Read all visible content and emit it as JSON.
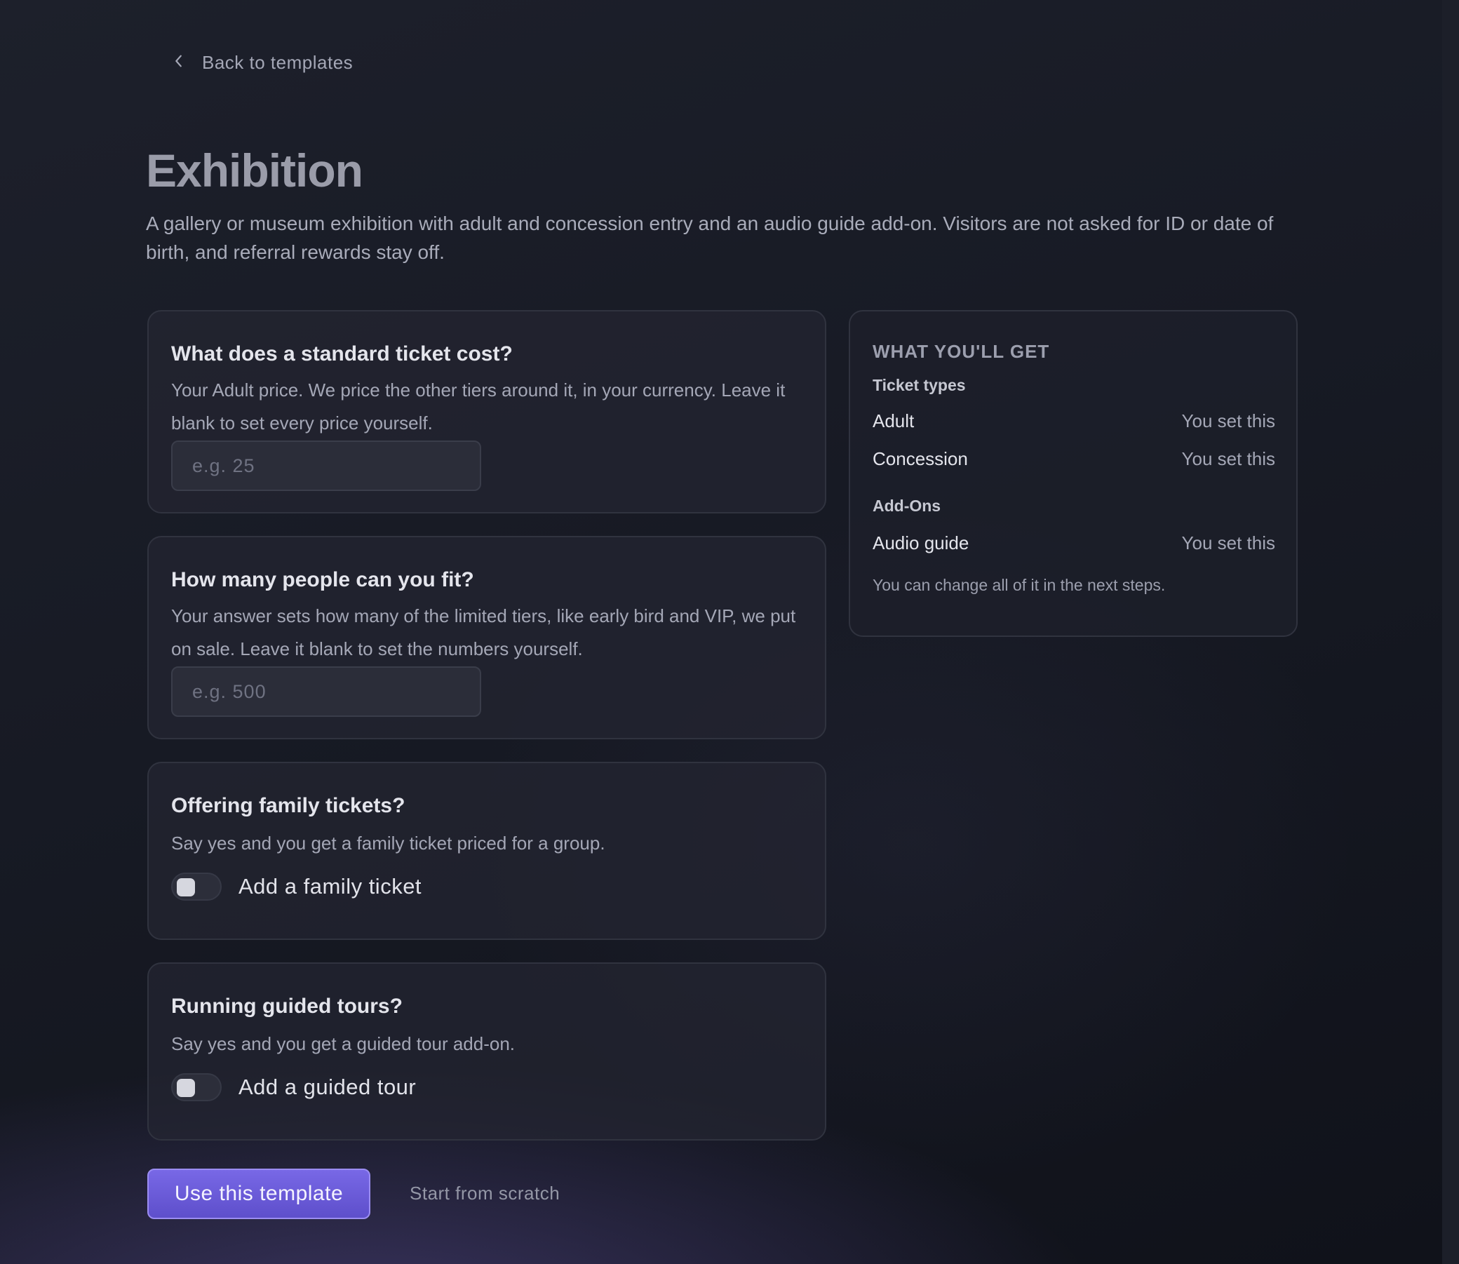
{
  "nav": {
    "back_label": "Back to templates"
  },
  "header": {
    "title": "Exhibition",
    "description": "A gallery or museum exhibition with adult and concession entry and an audio guide add-on. Visitors are not asked for ID or date of birth, and referral rewards stay off."
  },
  "questions": {
    "price": {
      "question": "What does a standard ticket cost?",
      "help": "Your Adult price. We price the other tiers around it, in your currency. Leave it blank to set every price yourself.",
      "value": "",
      "placeholder": "e.g. 25"
    },
    "capacity": {
      "question": "How many people can you fit?",
      "help": "Your answer sets how many of the limited tiers, like early bird and VIP, we put on sale. Leave it blank to set the numbers yourself.",
      "value": "",
      "placeholder": "e.g. 500"
    },
    "family": {
      "question": "Offering family tickets?",
      "help": "Say yes and you get a family ticket priced for a group.",
      "toggle_label": "Add a family ticket",
      "enabled": false
    },
    "tours": {
      "question": "Running guided tours?",
      "help": "Say yes and you get a guided tour add-on.",
      "toggle_label": "Add a guided tour",
      "enabled": false
    }
  },
  "summary": {
    "heading": "WHAT YOU'LL GET",
    "ticket_types_label": "Ticket types",
    "ticket_types": [
      {
        "name": "Adult",
        "value": "You set this"
      },
      {
        "name": "Concession",
        "value": "You set this"
      }
    ],
    "addons_label": "Add-Ons",
    "addons": [
      {
        "name": "Audio guide",
        "value": "You set this"
      }
    ],
    "note": "You can change all of it in the next steps."
  },
  "actions": {
    "primary_label": "Use this template",
    "secondary_label": "Start from scratch"
  },
  "colors": {
    "accent": "#6b5bd9",
    "background": "#171a24"
  },
  "icons": {
    "back": "chevron-left-icon"
  }
}
